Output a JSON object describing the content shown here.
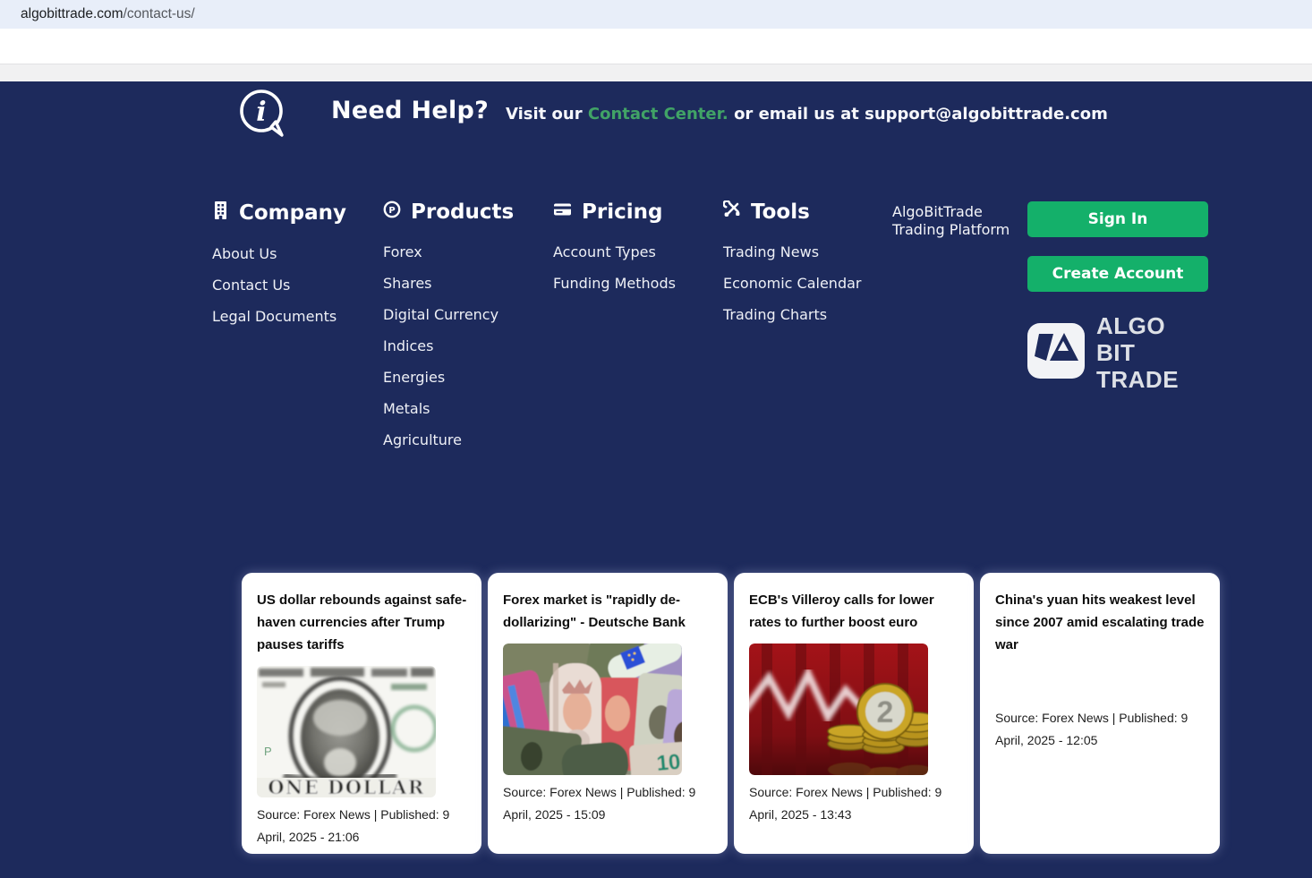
{
  "browser": {
    "url_domain": "algobittrade.com",
    "url_path": "/contact-us/"
  },
  "help": {
    "info_icon": "speech-bubble-info",
    "title": "Need Help?",
    "pre": "Visit our",
    "link": "Contact Center.",
    "post": "or email us at support@algobittrade.com"
  },
  "footer": {
    "columns": [
      {
        "icon": "building-icon",
        "title": "Company",
        "items": [
          "About Us",
          "Contact Us",
          "Legal Documents"
        ]
      },
      {
        "icon": "circle-p-icon",
        "title": "Products",
        "items": [
          "Forex",
          "Shares",
          "Digital Currency",
          "Indices",
          "Energies",
          "Metals",
          "Agriculture"
        ]
      },
      {
        "icon": "credit-card-icon",
        "title": "Pricing",
        "items": [
          "Account Types",
          "Funding Methods"
        ]
      },
      {
        "icon": "tools-icon",
        "title": "Tools",
        "items": [
          "Trading News",
          "Economic Calendar",
          "Trading Charts"
        ]
      }
    ],
    "platform_label": "AlgoBitTrade Trading Platform",
    "buttons": {
      "sign_in": "Sign In",
      "create_account": "Create Account"
    },
    "logo": {
      "line1": "ALGO BIT",
      "line2": "TRADE"
    }
  },
  "news": {
    "cards": [
      {
        "title": "US dollar rebounds against safe-haven currencies after Trump pauses tariffs",
        "image": "one-dollar-bill-photo",
        "image_text": "ONE DOLLAR",
        "source": "Source: Forex News | Published: 9 April, 2025 - 21:06"
      },
      {
        "title": "Forex market is \"rapidly de-dollarizing\" - Deutsche Bank",
        "image": "rolled-currency-notes-photo",
        "image_text": "10",
        "source": "Source: Forex News | Published: 9 April, 2025 - 15:09"
      },
      {
        "title": "ECB's Villeroy calls for lower rates to further boost euro",
        "image": "euro-coins-red-chart-photo",
        "image_text": "2",
        "source": "Source: Forex News | Published: 9 April, 2025 - 13:43"
      },
      {
        "title": "China's yuan hits weakest level since 2007 amid escalating trade war",
        "image": null,
        "source": "Source: Forex News | Published: 9 April, 2025 - 12:05"
      }
    ]
  },
  "colors": {
    "background_navy": "#1d2a5c",
    "button_green": "#14b06a",
    "link_green": "#41a366",
    "url_bar": "#e8eef9"
  }
}
